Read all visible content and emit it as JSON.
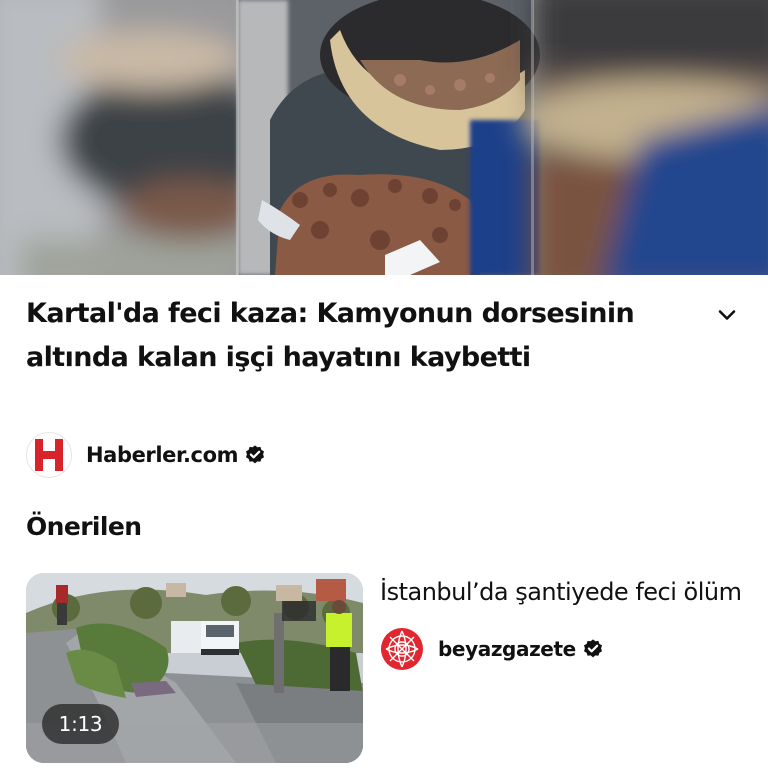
{
  "hero": {
    "image_alt": "blurred video frames of a bucket with soil"
  },
  "article": {
    "title": "Kartal'da feci kaza: Kamyonun dorsesinin altında kalan işçi hayatını kaybetti",
    "expand_icon": "chevron-down-icon"
  },
  "source": {
    "logo_letter": "H",
    "logo_color": "#d8232a",
    "name": "Haberler.com",
    "verified_icon": "verified-badge-icon"
  },
  "section": {
    "heading": "Önerilen"
  },
  "recommended": [
    {
      "title": "İstanbul’da şantiyede feci ölüm",
      "duration": "1:13",
      "source_name": "beyazgazete",
      "source_logo_color": "#e0262f",
      "verified_icon": "verified-badge-icon"
    }
  ]
}
